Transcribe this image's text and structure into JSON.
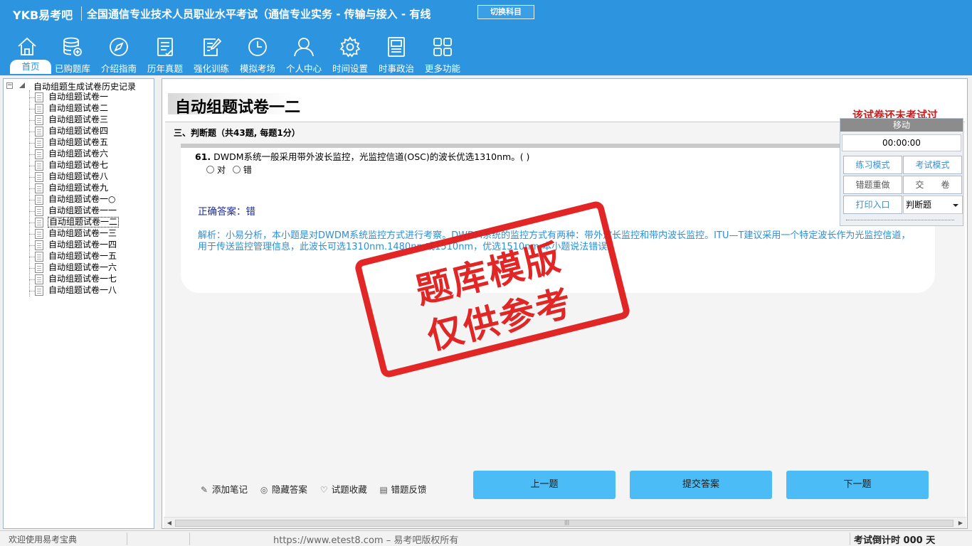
{
  "app": {
    "brand": "YKB易考吧",
    "title": "全国通信专业技术人员职业水平考试（通信专业实务 - 传输与接入 - 有线",
    "switch_label": "切换科目"
  },
  "nav": [
    {
      "label": "首页",
      "icon": "home-icon"
    },
    {
      "label": "已购题库",
      "icon": "database-icon"
    },
    {
      "label": "介绍指南",
      "icon": "compass-icon"
    },
    {
      "label": "历年真题",
      "icon": "checklist-icon"
    },
    {
      "label": "强化训练",
      "icon": "edit-icon"
    },
    {
      "label": "模拟考场",
      "icon": "clock-icon"
    },
    {
      "label": "个人中心",
      "icon": "user-icon"
    },
    {
      "label": "时间设置",
      "icon": "gear-icon"
    },
    {
      "label": "时事政治",
      "icon": "news-icon"
    },
    {
      "label": "更多功能",
      "icon": "grid-icon"
    }
  ],
  "tree": {
    "root": "自动组题生成试卷历史记录",
    "items": [
      "自动组题试卷一",
      "自动组题试卷二",
      "自动组题试卷三",
      "自动组题试卷四",
      "自动组题试卷五",
      "自动组题试卷六",
      "自动组题试卷七",
      "自动组题试卷八",
      "自动组题试卷九",
      "自动组题试卷一○",
      "自动组题试卷一一",
      "自动组题试卷一二",
      "自动组题试卷一三",
      "自动组题试卷一四",
      "自动组题试卷一五",
      "自动组题试卷一六",
      "自动组题试卷一七",
      "自动组题试卷一八"
    ],
    "selected_index": 11
  },
  "paper": {
    "title": "自动组题试卷一二",
    "status": "该试卷还未考试过",
    "section": "三、判断题（共43题, 每题1分）"
  },
  "question": {
    "number": "61.",
    "text": "DWDM系统一般采用带外波长监控，光监控信道(OSC)的波长优选1310nm。( )",
    "options": [
      "对",
      "错"
    ],
    "answer": "正确答案：错",
    "analysis": "解析：小易分析，本小题是对DWDM系统监控方式进行考察。DWDM系统的监控方式有两种：带外波长监控和带内波长监控。ITU—T建议采用一个特定波长作为光监控信道，用于传送监控管理信息，此波长可选1310nm.1480nm或1510nm，优选1510nm.本小题说法错误。"
  },
  "tools": [
    {
      "label": "添加笔记",
      "icon": "pencil-icon"
    },
    {
      "label": "隐藏答案",
      "icon": "eye-icon"
    },
    {
      "label": "试题收藏",
      "icon": "heart-icon"
    },
    {
      "label": "错题反馈",
      "icon": "feedback-icon"
    }
  ],
  "buttons": {
    "prev": "上一题",
    "submit": "提交答案",
    "next": "下一题"
  },
  "control": {
    "move": "移动",
    "timer": "00:00:00",
    "practice": "练习模式",
    "exam": "考试模式",
    "redo": "错题重做",
    "hand_in": "交　　卷",
    "print": "打印入口",
    "type_select": "判断题"
  },
  "stamp": {
    "line1": "题库模版",
    "line2": "仅供参考"
  },
  "status_bar": {
    "left": "欢迎使用易考宝典",
    "middle": "https://www.etest8.com – 易考吧版权所有",
    "right": "考试倒计时 000 天"
  },
  "colors": {
    "header": "#2d94e0",
    "button": "#4bbcf6",
    "stamp": "#e11b1b",
    "status_red": "#d21a1a",
    "analysis": "#2c8fd8"
  }
}
